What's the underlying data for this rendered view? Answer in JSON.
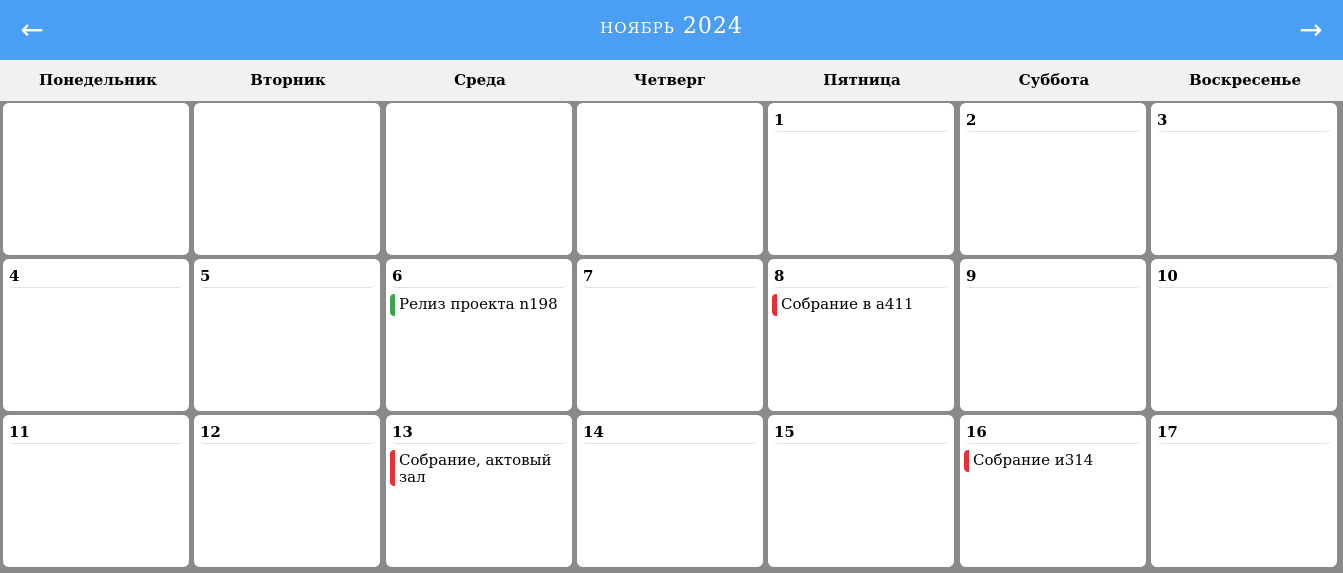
{
  "header": {
    "prev_label": "←",
    "next_label": "→",
    "title": "Ноябрь 2024",
    "background": "#4a9ff5"
  },
  "weekdays": [
    "Понедельник",
    "Вторник",
    "Среда",
    "Четверг",
    "Пятница",
    "Суббота",
    "Воскресенье"
  ],
  "event_colors": {
    "green": "#3aa84a",
    "red": "#e8303a"
  },
  "weeks": [
    {
      "days": [
        {
          "day": ""
        },
        {
          "day": ""
        },
        {
          "day": ""
        },
        {
          "day": ""
        },
        {
          "day": "1"
        },
        {
          "day": "2"
        },
        {
          "day": "3"
        }
      ]
    },
    {
      "days": [
        {
          "day": "4"
        },
        {
          "day": "5"
        },
        {
          "day": "6",
          "event": {
            "title": "Релиз проекта n198",
            "color": "#3aa84a"
          }
        },
        {
          "day": "7"
        },
        {
          "day": "8",
          "event": {
            "title": "Собрание в а411",
            "color": "#e8303a"
          }
        },
        {
          "day": "9"
        },
        {
          "day": "10"
        }
      ]
    },
    {
      "days": [
        {
          "day": "11"
        },
        {
          "day": "12"
        },
        {
          "day": "13",
          "event": {
            "title": "Собрание, актовый зал",
            "color": "#e8303a"
          }
        },
        {
          "day": "14"
        },
        {
          "day": "15"
        },
        {
          "day": "16",
          "event": {
            "title": "Собрание и314",
            "color": "#e8303a"
          }
        },
        {
          "day": "17"
        }
      ]
    }
  ]
}
